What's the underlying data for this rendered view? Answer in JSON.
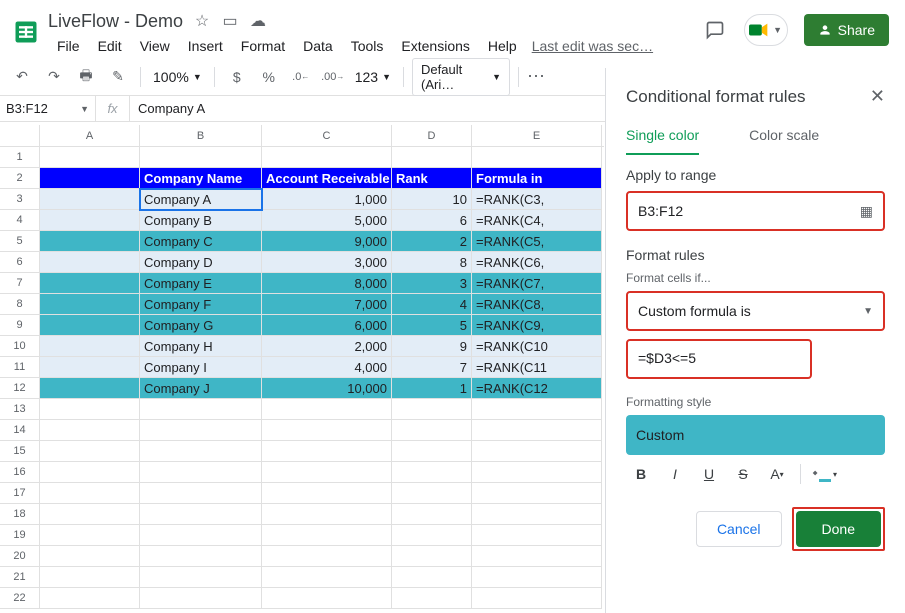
{
  "header": {
    "doc_title": "LiveFlow - Demo",
    "last_edit": "Last edit was sec…",
    "share_label": "Share",
    "menu": [
      "File",
      "Edit",
      "View",
      "Insert",
      "Format",
      "Data",
      "Tools",
      "Extensions",
      "Help"
    ]
  },
  "toolbar": {
    "zoom": "100%",
    "currency": "$",
    "percent": "%",
    "dec_dec": ".0",
    "dec_inc": ".00",
    "num_fmt": "123",
    "font": "Default (Ari…"
  },
  "fx": {
    "range": "B3:F12",
    "formula": "Company A"
  },
  "columns": [
    "A",
    "B",
    "C",
    "D",
    "E"
  ],
  "header_row": {
    "b": "Company Name",
    "c": "Account Receivable",
    "d": "Rank",
    "e": "Formula in"
  },
  "rows": [
    {
      "n": "3",
      "b": "Company A",
      "c": "1,000",
      "d": "10",
      "e": "=RANK(C3,",
      "cls": "light",
      "sel": true
    },
    {
      "n": "4",
      "b": "Company B",
      "c": "5,000",
      "d": "6",
      "e": "=RANK(C4,",
      "cls": "light"
    },
    {
      "n": "5",
      "b": "Company C",
      "c": "9,000",
      "d": "2",
      "e": "=RANK(C5,",
      "cls": "teal"
    },
    {
      "n": "6",
      "b": "Company D",
      "c": "3,000",
      "d": "8",
      "e": "=RANK(C6,",
      "cls": "light"
    },
    {
      "n": "7",
      "b": "Company E",
      "c": "8,000",
      "d": "3",
      "e": "=RANK(C7,",
      "cls": "teal"
    },
    {
      "n": "8",
      "b": "Company F",
      "c": "7,000",
      "d": "4",
      "e": "=RANK(C8,",
      "cls": "teal"
    },
    {
      "n": "9",
      "b": "Company G",
      "c": "6,000",
      "d": "5",
      "e": "=RANK(C9,",
      "cls": "teal"
    },
    {
      "n": "10",
      "b": "Company H",
      "c": "2,000",
      "d": "9",
      "e": "=RANK(C10",
      "cls": "light"
    },
    {
      "n": "11",
      "b": "Company I",
      "c": "4,000",
      "d": "7",
      "e": "=RANK(C11",
      "cls": "light"
    },
    {
      "n": "12",
      "b": "Company J",
      "c": "10,000",
      "d": "1",
      "e": "=RANK(C12",
      "cls": "teal"
    }
  ],
  "empty_rows": [
    "1",
    "13",
    "14",
    "15",
    "16",
    "17",
    "18",
    "19",
    "20",
    "21",
    "22"
  ],
  "panel": {
    "title": "Conditional format rules",
    "tab_single": "Single color",
    "tab_scale": "Color scale",
    "apply_label": "Apply to range",
    "range_value": "B3:F12",
    "rules_label": "Format rules",
    "cells_if_label": "Format cells if...",
    "formula_type": "Custom formula is",
    "formula_value": "=$D3<=5",
    "style_label": "Formatting style",
    "style_value": "Custom",
    "cancel": "Cancel",
    "done": "Done"
  }
}
